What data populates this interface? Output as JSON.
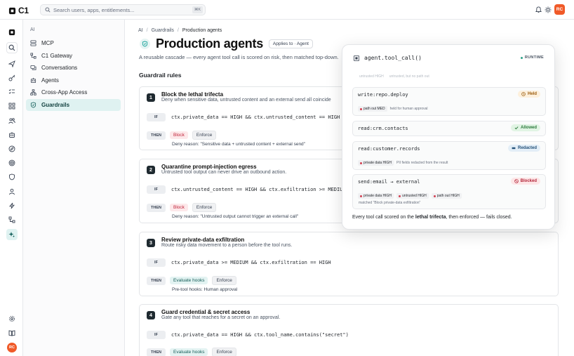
{
  "brand": {
    "word": "C1"
  },
  "search": {
    "placeholder": "Search users, apps, entitlements...",
    "shortcut": "⌘K"
  },
  "user": {
    "initials": "RC",
    "avatar_color": "#f05a28"
  },
  "accent": "#16a39a",
  "nav": {
    "section": "AI",
    "items": [
      {
        "label": "MCP",
        "icon": "server-icon"
      },
      {
        "label": "C1 Gateway",
        "icon": "gateway-icon"
      },
      {
        "label": "Conversations",
        "icon": "chat-icon"
      },
      {
        "label": "Agents",
        "icon": "agent-icon"
      },
      {
        "label": "Cross-App Access",
        "icon": "hierarchy-icon"
      },
      {
        "label": "Guardrails",
        "icon": "shield-icon",
        "active": true
      }
    ]
  },
  "breadcrumb": [
    "AI",
    "Guardrails",
    "Production agents"
  ],
  "page": {
    "title": "Production agents",
    "applies_badge": "Applies to · Agent",
    "description": "A reusable cascade — every agent tool call is scored on risk, then matched top-down.",
    "rules_heading": "Guardrail rules"
  },
  "rules": [
    {
      "number": "1",
      "title": "Block the lethal trifecta",
      "description": "Deny when sensitive data, untrusted content and an external send all coincide",
      "if_label": "IF",
      "condition": "ctx.private_data == HIGH && ctx.untrusted_content == HIGH",
      "then_label": "THEN",
      "actions": [
        {
          "label": "Block",
          "kind": "block"
        },
        {
          "label": "Enforce",
          "kind": "enforce"
        }
      ],
      "note": "Deny reason: \"Sensitive data + untrusted content + external send\""
    },
    {
      "number": "2",
      "title": "Quarantine prompt-injection egress",
      "description": "Untrusted tool output can never drive an outbound action.",
      "if_label": "IF",
      "condition": "ctx.untrusted_content == HIGH && ctx.exfiltration >= MEDIUM",
      "then_label": "THEN",
      "actions": [
        {
          "label": "Block",
          "kind": "block"
        },
        {
          "label": "Enforce",
          "kind": "enforce"
        }
      ],
      "note": "Deny reason: \"Untrusted output cannot trigger an external call\""
    },
    {
      "number": "3",
      "title": "Review private-data exfiltration",
      "description": "Route risky data movement to a person before the tool runs.",
      "if_label": "IF",
      "condition": "ctx.private_data >= MEDIUM && ctx.exfiltration == HIGH",
      "then_label": "THEN",
      "actions": [
        {
          "label": "Evaluate hooks",
          "kind": "eval"
        },
        {
          "label": "Enforce",
          "kind": "enforce"
        }
      ],
      "note": "Pre-tool hooks: Human approval"
    },
    {
      "number": "4",
      "title": "Guard credential & secret access",
      "description": "Gate any tool that reaches for a secret on an approval.",
      "if_label": "IF",
      "condition": "ctx.private_data == HIGH && ctx.tool_name.contains(\"secret\")",
      "then_label": "THEN",
      "actions": [
        {
          "label": "Evaluate hooks",
          "kind": "eval"
        },
        {
          "label": "Enforce",
          "kind": "enforce"
        }
      ],
      "note": ""
    }
  ],
  "popover": {
    "title": "agent.tool_call()",
    "runtime_label": "RUNTIME",
    "faded": [
      "untrusted HIGH",
      "untrusted, but no path out"
    ],
    "calls": [
      {
        "name": "write:repo.deploy",
        "status": "Held",
        "kind": "held",
        "pills": [
          "path out MED"
        ],
        "text": "held for human approval",
        "extra": ""
      },
      {
        "name": "read:crm.contacts",
        "status": "Allowed",
        "kind": "allowed",
        "pills": [],
        "text": "",
        "extra": ""
      },
      {
        "name": "read:customer.records",
        "status": "Redacted",
        "kind": "redacted",
        "pills": [
          "private data HIGH"
        ],
        "text": "PII fields redacted from the result",
        "extra": ""
      },
      {
        "name": "send:email → external",
        "status": "Blocked",
        "kind": "blocked",
        "pills": [
          "private data HIGH",
          "untrusted HIGH",
          "path out HIGH"
        ],
        "text": "",
        "extra": "matched \"Block private-data exfiltration\""
      }
    ],
    "footer_pre": "Every tool call scored on the ",
    "footer_bold": "lethal trifecta",
    "footer_post": ", then enforced — fails closed."
  }
}
